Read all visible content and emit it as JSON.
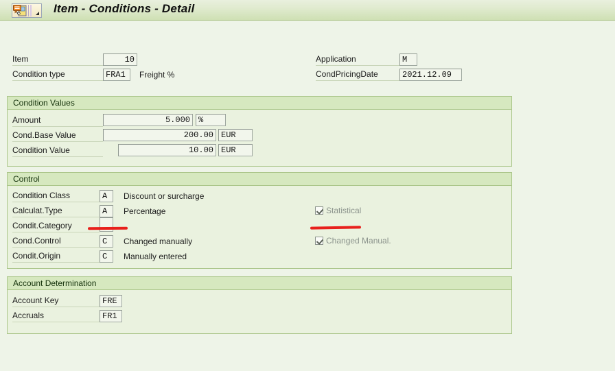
{
  "titlebar": {
    "title": "Item - Conditions - Detail",
    "icon": "condition-detail-icon",
    "menu_arrow": "dropdown-arrow-icon"
  },
  "header_form": {
    "left": [
      {
        "label": "Item",
        "value": "10"
      },
      {
        "label": "Condition type",
        "value": "FRA1",
        "description": "Freight %"
      }
    ],
    "right": [
      {
        "label": "Application",
        "value": "M"
      },
      {
        "label": "CondPricingDate",
        "value": "2021.12.09"
      }
    ]
  },
  "condition_values": {
    "title": "Condition Values",
    "rows": [
      {
        "label": "Amount",
        "value": "5.000",
        "unit": "%"
      },
      {
        "label": "Cond.Base Value",
        "value": "200.00",
        "unit": "EUR"
      },
      {
        "label": "Condition Value",
        "value": "10.00",
        "unit": "EUR"
      }
    ]
  },
  "control": {
    "title": "Control",
    "rows": [
      {
        "label": "Condition Class",
        "value": "A",
        "description": "Discount or surcharge"
      },
      {
        "label": "Calculat.Type",
        "value": "A",
        "description": "Percentage"
      },
      {
        "label": "Condit.Category",
        "value": "",
        "description": ""
      },
      {
        "label": "Cond.Control",
        "value": "C",
        "description": "Changed manually"
      },
      {
        "label": "Condit.Origin",
        "value": "C",
        "description": "Manually entered"
      }
    ],
    "checkboxes": [
      {
        "label": "Statistical",
        "checked": true
      },
      {
        "label": "Changed Manual.",
        "checked": true
      }
    ]
  },
  "account_determination": {
    "title": "Account Determination",
    "rows": [
      {
        "label": "Account Key",
        "value": "FRE"
      },
      {
        "label": "Accruals",
        "value": "FR1"
      }
    ]
  },
  "annotations": {
    "color": "#e8201c",
    "marks": [
      {
        "name": "condition-category-underline"
      },
      {
        "name": "changed-manual-underline"
      }
    ]
  }
}
